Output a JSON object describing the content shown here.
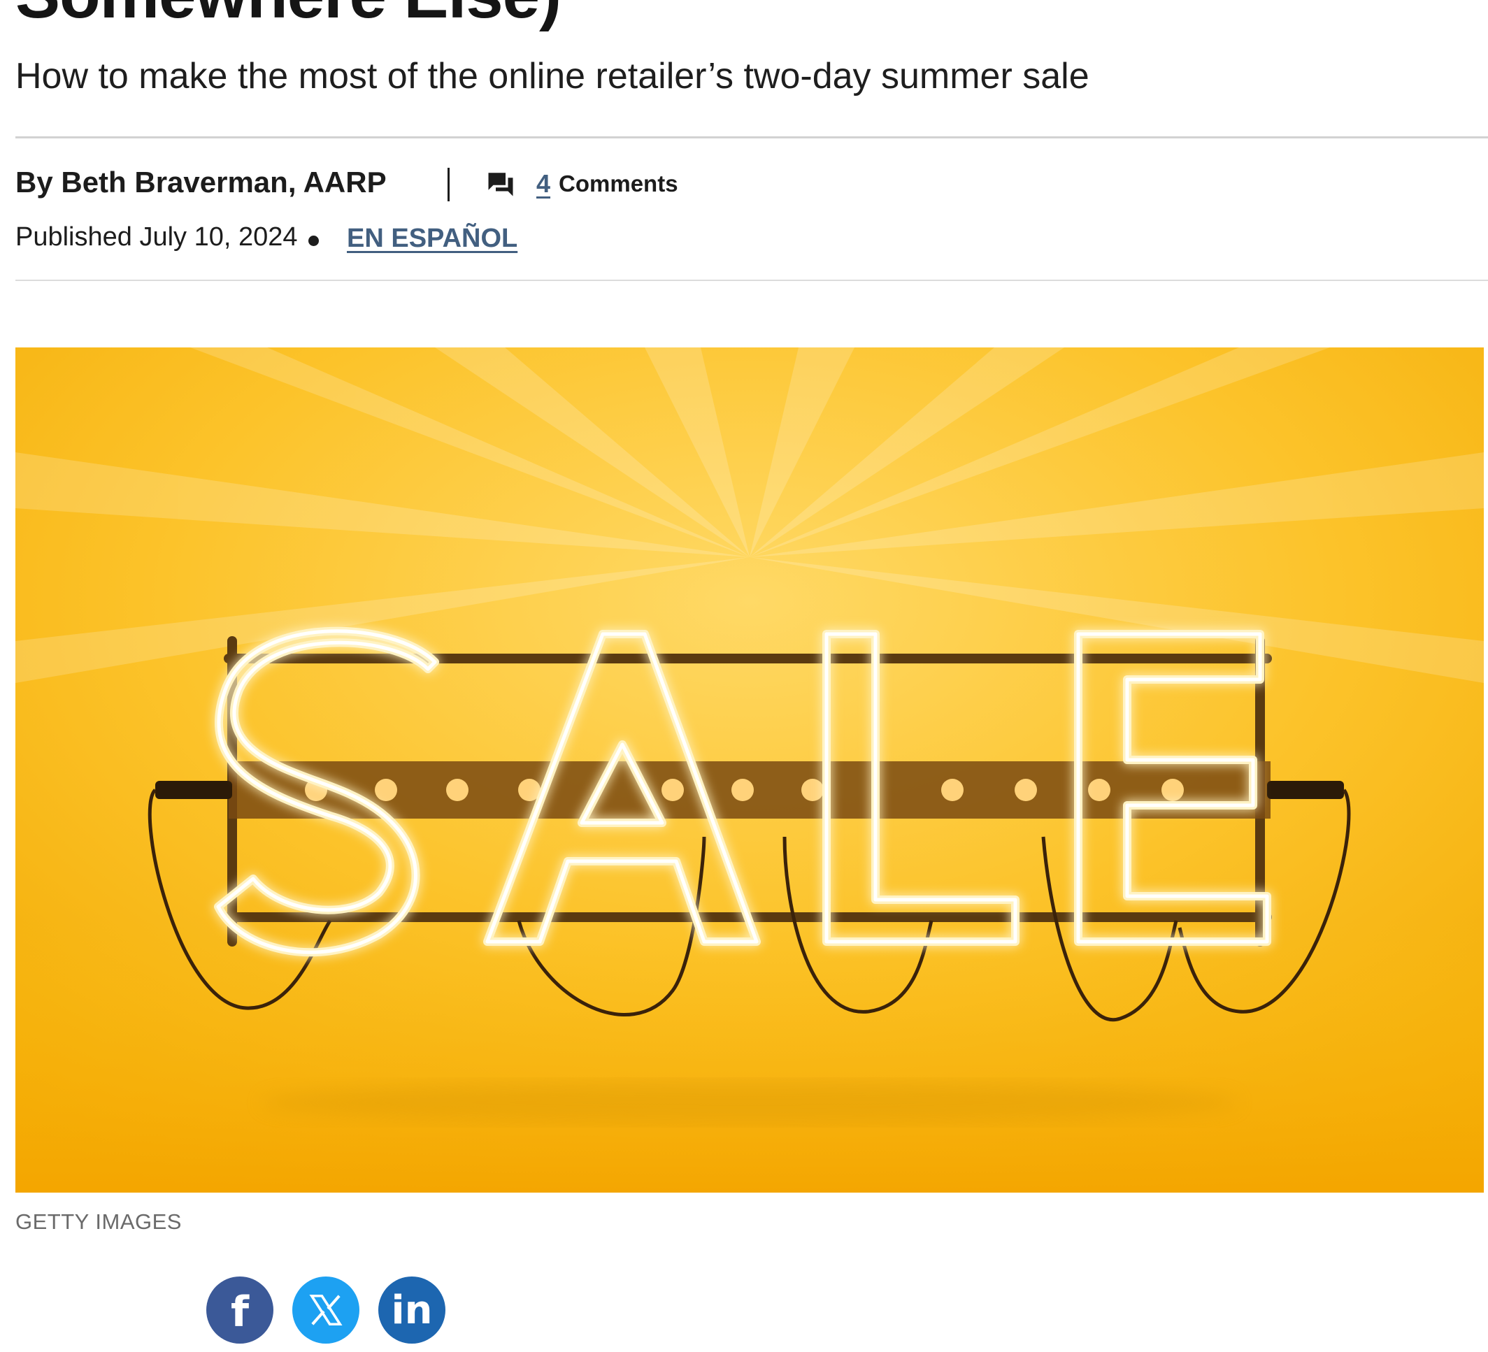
{
  "article": {
    "headline_fragment": "Somewhere Else)",
    "subtitle": "How to make the most of the online retailer’s two-day summer sale",
    "byline": "By Beth Braverman,  AARP",
    "comments": {
      "count": "4",
      "label": "Comments",
      "icon": "comments-icon"
    },
    "published": "Published July 10, 2024",
    "spanish_link": "EN ESPAÑOL"
  },
  "hero_image": {
    "sign_text": "SALE",
    "credit": "GETTY IMAGES"
  },
  "share": {
    "facebook": {
      "glyph": "f",
      "icon": "facebook-icon",
      "color": "#3b5998"
    },
    "x": {
      "icon": "x-logo-icon",
      "color": "#1da1f2"
    },
    "linkedin": {
      "glyph": "in",
      "icon": "linkedin-icon",
      "color": "#1d66b0"
    }
  },
  "colors": {
    "link": "#425f80",
    "rule": "#d2d2d2",
    "image_base": "#f6b800"
  }
}
